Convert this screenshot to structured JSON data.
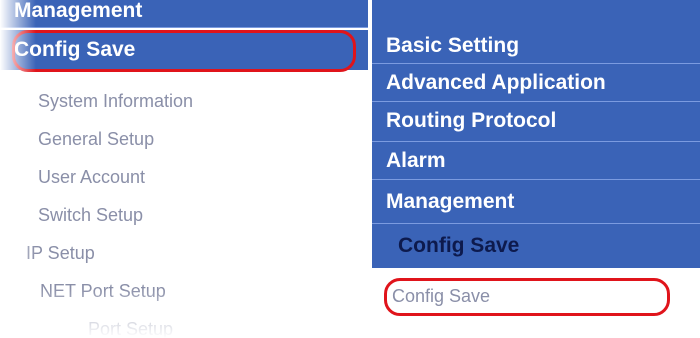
{
  "left_menu": {
    "sections": {
      "management": "Management",
      "config_save": "Config Save"
    },
    "items": [
      "System Information",
      "General Setup",
      "User Account",
      "Switch Setup",
      "IP Setup",
      "NET Port Setup",
      "Port Setup"
    ]
  },
  "right_menu": {
    "sections": [
      "Basic Setting",
      "Advanced Application",
      "Routing Protocol",
      "Alarm",
      "Management",
      "Config Save"
    ],
    "sub_item": "Config Save"
  },
  "colors": {
    "menu_blue": "#3a63b7",
    "selected_text": "#0d1a4d",
    "highlight_red": "#e0141b",
    "sub_text": "#8a8fa8"
  }
}
